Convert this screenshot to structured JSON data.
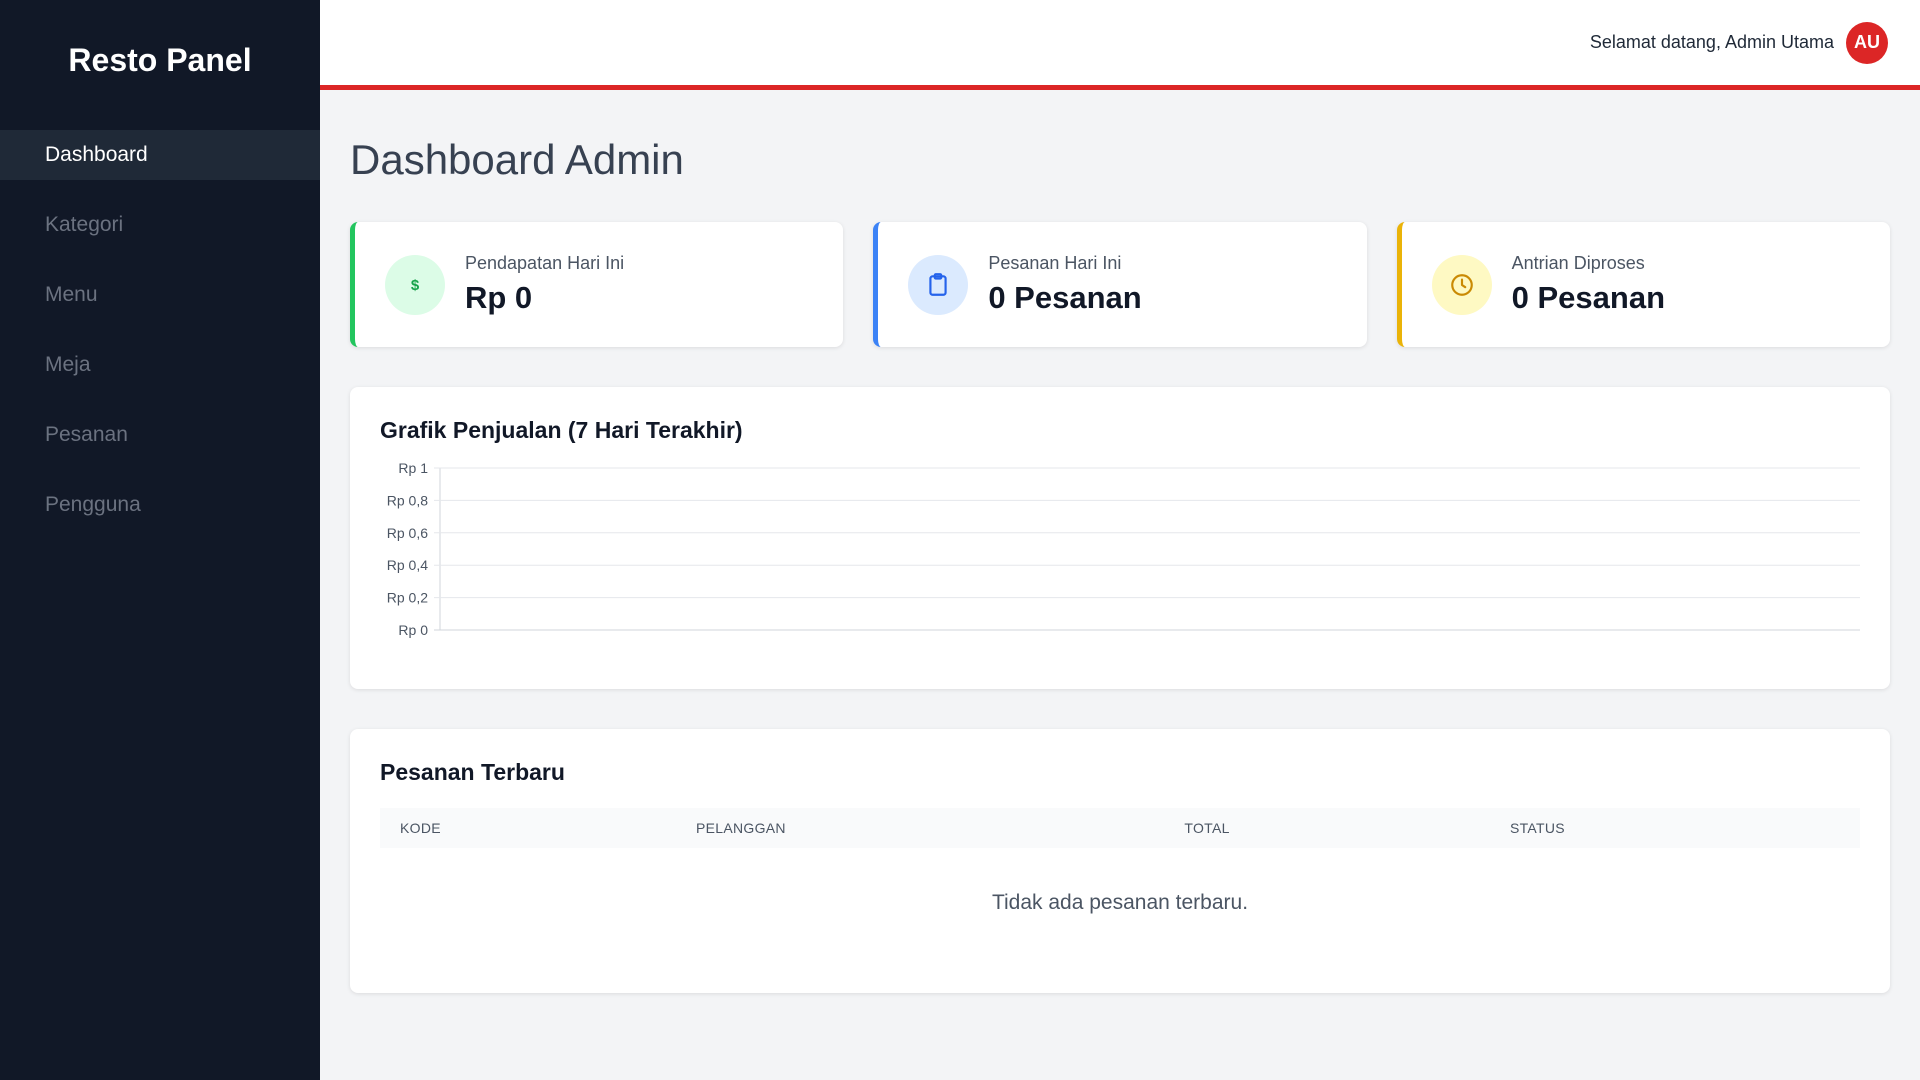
{
  "sidebar": {
    "brand": "Resto Panel",
    "items": [
      {
        "label": "Dashboard"
      },
      {
        "label": "Kategori"
      },
      {
        "label": "Menu"
      },
      {
        "label": "Meja"
      },
      {
        "label": "Pesanan"
      },
      {
        "label": "Pengguna"
      }
    ]
  },
  "header": {
    "welcome": "Selamat datang, Admin Utama",
    "avatar_initials": "AU"
  },
  "page": {
    "title": "Dashboard Admin"
  },
  "stats": [
    {
      "label": "Pendapatan Hari Ini",
      "value": "Rp 0",
      "icon": "dollar-icon",
      "color": "#22c55e"
    },
    {
      "label": "Pesanan Hari Ini",
      "value": "0 Pesanan",
      "icon": "clipboard-icon",
      "color": "#3b82f6"
    },
    {
      "label": "Antrian Diproses",
      "value": "0 Pesanan",
      "icon": "clock-icon",
      "color": "#eab308"
    }
  ],
  "chart": {
    "title": "Grafik Penjualan (7 Hari Terakhir)"
  },
  "chart_data": {
    "type": "line",
    "title": "Grafik Penjualan (7 Hari Terakhir)",
    "xlabel": "",
    "ylabel": "",
    "series": [],
    "yticks": [
      "Rp 1",
      "Rp 0,8",
      "Rp 0,6",
      "Rp 0,4",
      "Rp 0,2",
      "Rp 0"
    ],
    "ylim": [
      0,
      1
    ],
    "grid": true
  },
  "orders": {
    "title": "Pesanan Terbaru",
    "columns": [
      "KODE",
      "PELANGGAN",
      "TOTAL",
      "STATUS"
    ],
    "empty_message": "Tidak ada pesanan terbaru."
  },
  "colors": {
    "accent": "#dc2626",
    "sidebar_bg": "#111827"
  }
}
